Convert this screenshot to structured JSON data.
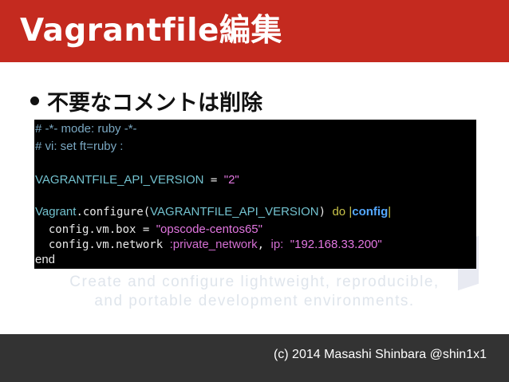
{
  "header": {
    "title": "Vagrantfile編集",
    "color": "#c42a1f"
  },
  "bullet": {
    "text": "不要なコメントは削除"
  },
  "watermark": {
    "line1": "Create and configure lightweight, reproducible,",
    "line2": "and portable development environments."
  },
  "code": {
    "line1": "# -*- mode: ruby -*-",
    "line2": "# vi: set ft=ruby :",
    "line4_const": "VAGRANTFILE_API_VERSION",
    "line4_op": " = ",
    "line4_str": "\"2\"",
    "line6_class": "Vagrant",
    "line6_method": ".configure(",
    "line6_arg": "VAGRANTFILE_API_VERSION",
    "line6_close": ") ",
    "line6_do": "do",
    "line6_pipe1": " |",
    "line6_var": "config",
    "line6_pipe2": "|",
    "line7_code": "  config.vm.box = ",
    "line7_str": "\"opscode-centos65\"",
    "line8_code": "  config.vm.network ",
    "line8_sym": ":private_network",
    "line8_comma": ", ",
    "line8_key": "ip:",
    "line8_space": " ",
    "line8_str": "\"192.168.33.200\"",
    "line9": "end"
  },
  "footer": {
    "text": "(c) 2014 Masashi Shinbara @shin1x1",
    "color": "#333333"
  }
}
